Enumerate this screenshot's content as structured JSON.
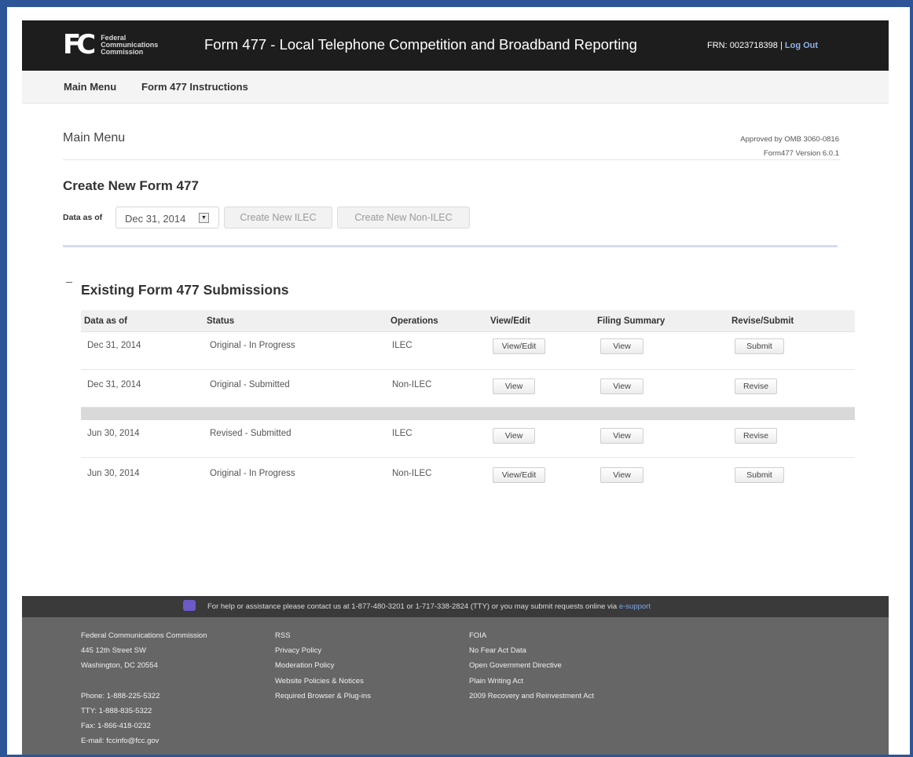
{
  "header": {
    "logo_mark": "FC",
    "logo_lines": [
      "Federal",
      "Communications",
      "Commission"
    ],
    "title": "Form 477 - Local Telephone Competition and Broadband Reporting",
    "frn": "FRN: 0023718398 |",
    "logout": "Log Out"
  },
  "nav": {
    "main_menu": "Main Menu",
    "instructions": "Form 477 Instructions"
  },
  "page": {
    "title": "Main Menu",
    "omb_line1": "Approved by OMB 3060-0816",
    "omb_line2": "Form477 Version 6.0.1"
  },
  "create": {
    "title": "Create New Form 477",
    "data_as_of_label": "Data as of",
    "selected_date": "Dec 31, 2014",
    "btn_ilec": "Create New ILEC",
    "btn_non_ilec": "Create New Non-ILEC"
  },
  "existing": {
    "title": "Existing Form 477 Submissions",
    "columns": [
      "Data as of",
      "Status",
      "Operations",
      "View/Edit",
      "Filing Summary",
      "Revise/Submit"
    ],
    "rows": [
      {
        "date": "Dec 31, 2014",
        "status": "Original - In Progress",
        "operations": "ILEC",
        "view_edit": "View/Edit",
        "summary": "View",
        "action": "Submit"
      },
      {
        "date": "Dec 31, 2014",
        "status": "Original - Submitted",
        "operations": "Non-ILEC",
        "view_edit": "View",
        "summary": "View",
        "action": "Revise"
      },
      {
        "date": "Jun 30, 2014",
        "status": "Revised - Submitted",
        "operations": "ILEC",
        "view_edit": "View",
        "summary": "View",
        "action": "Revise"
      },
      {
        "date": "Jun 30, 2014",
        "status": "Original - In Progress",
        "operations": "Non-ILEC",
        "view_edit": "View/Edit",
        "summary": "View",
        "action": "Submit"
      }
    ]
  },
  "footer": {
    "help_text": "For help or assistance please contact us at 1-877-480-3201 or 1-717-338-2824 (TTY) or you may submit requests online via",
    "help_link": "e-support",
    "col1": [
      "Federal Communications Commission",
      "445 12th Street SW",
      "Washington, DC 20554"
    ],
    "col1_contact": [
      "Phone: 1-888-225-5322",
      "TTY: 1-888-835-5322",
      "Fax: 1-866-418-0232",
      "E-mail: fccinfo@fcc.gov"
    ],
    "col2": [
      "RSS",
      "Privacy Policy",
      "Moderation Policy",
      "Website Policies & Notices",
      "Required Browser & Plug-ins"
    ],
    "col3": [
      "FOIA",
      "No Fear Act Data",
      "Open Government Directive",
      "Plain Writing Act",
      "2009 Recovery and Reinvestment Act"
    ]
  },
  "colors": {
    "frame": "#2d5597",
    "header_bg": "#1d1d1d",
    "footer_bg": "#666666",
    "link": "#7fa8e6"
  }
}
